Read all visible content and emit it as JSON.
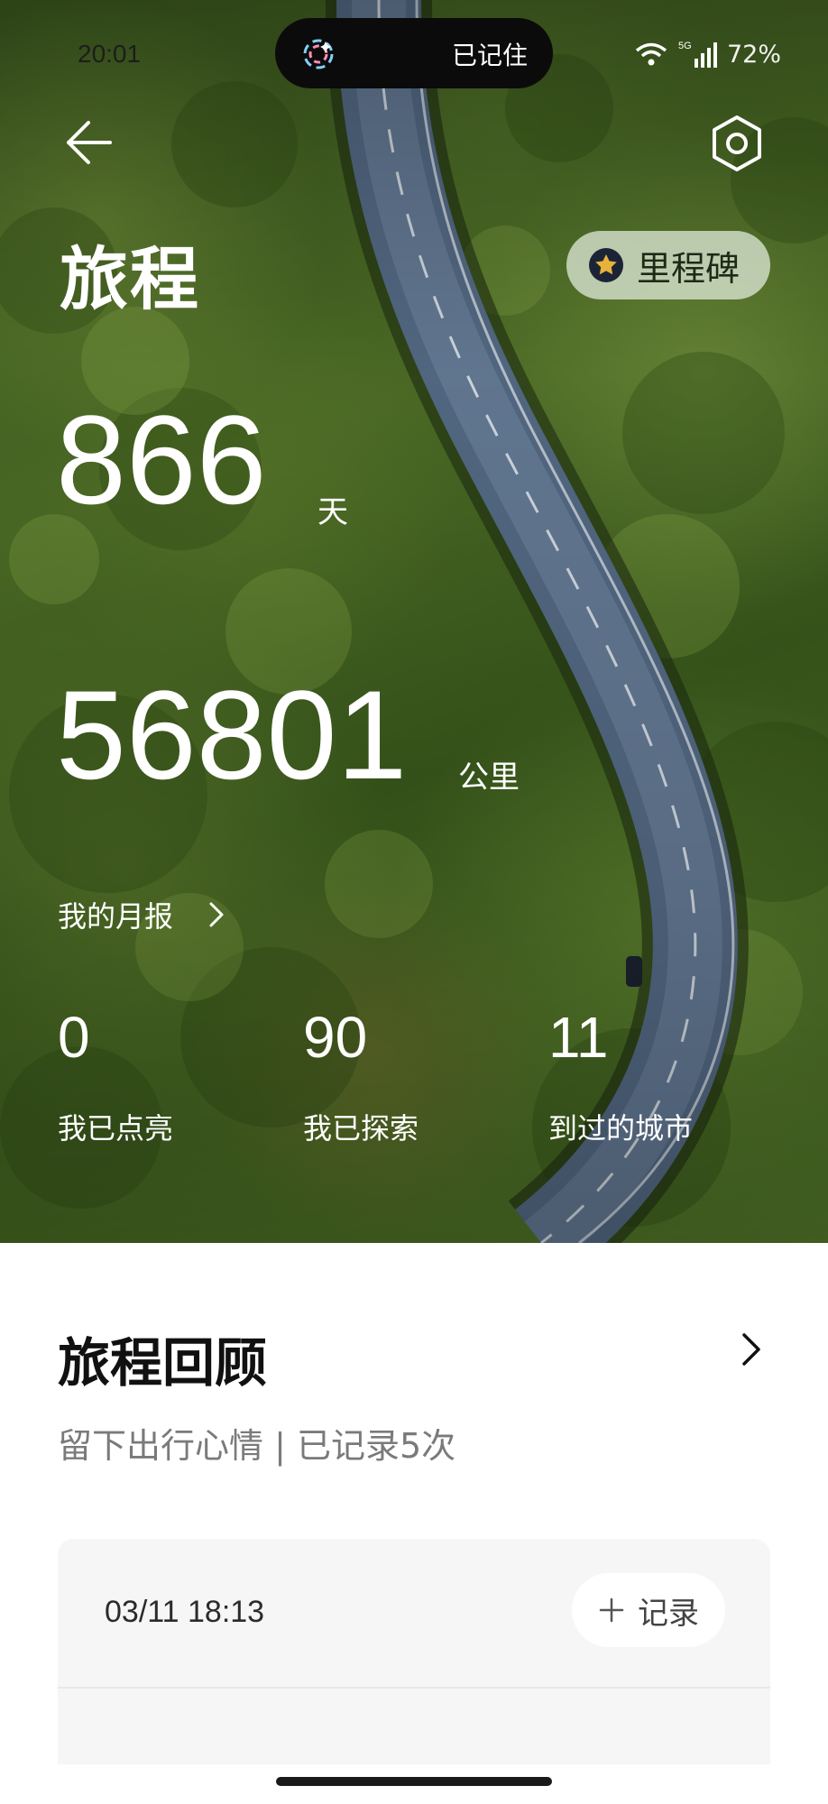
{
  "status_bar": {
    "time": "20:01",
    "pill_text": "已记住",
    "network": "5G",
    "battery": "72%"
  },
  "header": {
    "title": "旅程",
    "milestone_label": "里程碑"
  },
  "stats": {
    "days_value": "866",
    "days_unit": "天",
    "km_value": "56801",
    "km_unit": "公里",
    "monthly_report_label": "我的月报",
    "items": [
      {
        "value": "0",
        "label": "我已点亮"
      },
      {
        "value": "90",
        "label": "我已探索"
      },
      {
        "value": "11",
        "label": "到过的城市"
      }
    ]
  },
  "review": {
    "title": "旅程回顾",
    "subtitle": "留下出行心情 | 已记录5次",
    "entry_time": "03/11 18:13",
    "add_label": "记录"
  },
  "colors": {
    "accent_gold": "#e7b23a",
    "text_primary": "#111111",
    "text_secondary": "#7a7a7a"
  }
}
